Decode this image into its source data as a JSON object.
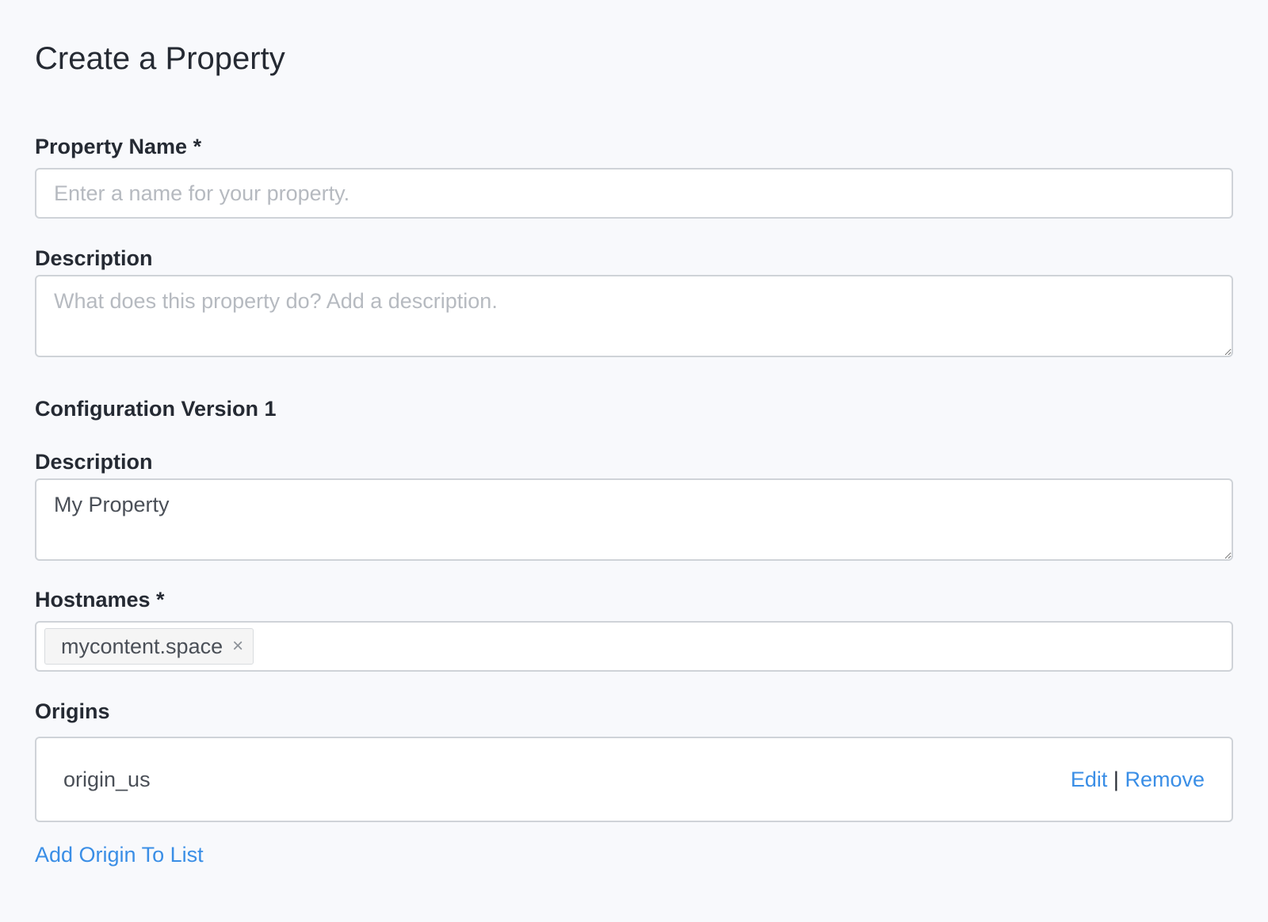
{
  "page": {
    "title": "Create a Property"
  },
  "property_name": {
    "label": "Property Name *",
    "value": "",
    "placeholder": "Enter a name for your property."
  },
  "property_description": {
    "label": "Description",
    "value": "",
    "placeholder": "What does this property do? Add a description."
  },
  "configuration": {
    "heading": "Configuration Version 1",
    "description": {
      "label": "Description",
      "value": "My Property"
    }
  },
  "hostnames": {
    "label": "Hostnames *",
    "tags": [
      {
        "value": "mycontent.space",
        "remove_glyph": "×"
      }
    ]
  },
  "origins": {
    "label": "Origins",
    "items": [
      {
        "name": "origin_us",
        "edit_label": "Edit",
        "separator": "|",
        "remove_label": "Remove"
      }
    ],
    "add_label": "Add Origin To List"
  },
  "colors": {
    "background": "#f8f9fc",
    "text": "#252a33",
    "link": "#3a8ee6",
    "border": "#cfd3d8",
    "placeholder": "#b6bac0"
  },
  "icons": {
    "tag_remove": "close-icon"
  }
}
